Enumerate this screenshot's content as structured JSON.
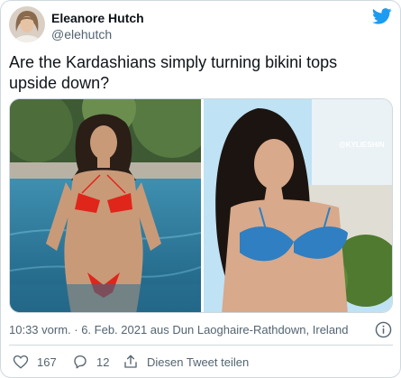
{
  "author": {
    "display_name": "Eleanore Hutch",
    "handle": "@elehutch"
  },
  "tweet": {
    "text": "Are the Kardashians simply turning bikini tops upside down?"
  },
  "media": {
    "photo_1_icon": "photo",
    "photo_2_icon": "photo",
    "photo_2_tag": "@KYLIESHIN"
  },
  "meta": {
    "timestamp": "10:33 vorm. · 6. Feb. 2021 aus Dun Laoghaire-Rathdown, Ireland"
  },
  "actions": {
    "like_count": "167",
    "reply_count": "12",
    "share_label": "Diesen Tweet teilen"
  },
  "colors": {
    "twitter_blue": "#1d9bf0",
    "text_primary": "#0f1419",
    "text_secondary": "#536471",
    "border": "#cfd9de"
  },
  "icons": {
    "brand": "twitter-bird-icon",
    "info": "info-icon",
    "like": "heart-icon",
    "reply": "reply-icon",
    "share": "share-icon"
  }
}
